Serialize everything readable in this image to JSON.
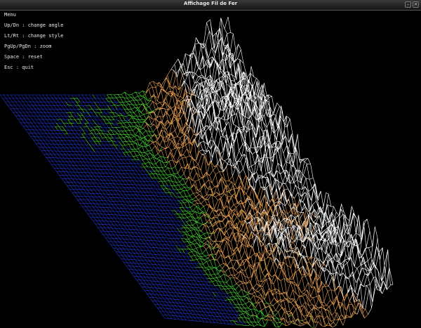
{
  "window": {
    "title": "Affichage Fil de Fer"
  },
  "menu": {
    "heading": "Menu",
    "items": [
      "Up/Dn : change angle",
      "Lt/Rt : change style",
      "PgUp/PgDn : zoom",
      "Space : reset",
      "Esc : quit"
    ]
  },
  "colors": {
    "water": "#2233cc",
    "lowland": "#44dd33",
    "hills": "#e8a050",
    "peaks": "#ffffff",
    "background": "#000000"
  },
  "icons": [
    "minimize-icon",
    "close-icon"
  ]
}
